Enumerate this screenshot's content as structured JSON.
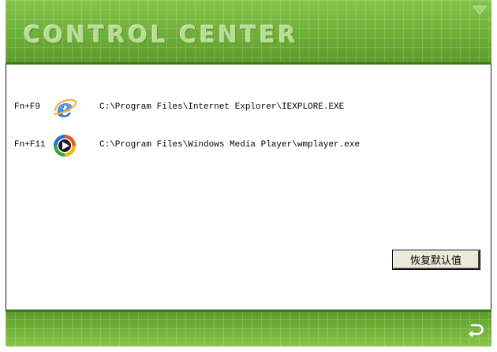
{
  "header": {
    "title": "CONTROL CENTER",
    "menu_icon": "triangle-down-icon"
  },
  "hotkeys": [
    {
      "key": "Fn+F9",
      "icon": "internet-explorer-icon",
      "path": "C:\\Program Files\\Internet Explorer\\IEXPLORE.EXE"
    },
    {
      "key": "Fn+F11",
      "icon": "windows-media-player-icon",
      "path": "C:\\Program Files\\Windows Media Player\\wmplayer.exe"
    }
  ],
  "buttons": {
    "restore_defaults": "恢复默认值"
  },
  "footer": {
    "back_icon": "return-arrow-icon"
  },
  "colors": {
    "accent_green": "#6aae36",
    "dark_green": "#3f7a1a",
    "title_text": "#b9dc95"
  }
}
